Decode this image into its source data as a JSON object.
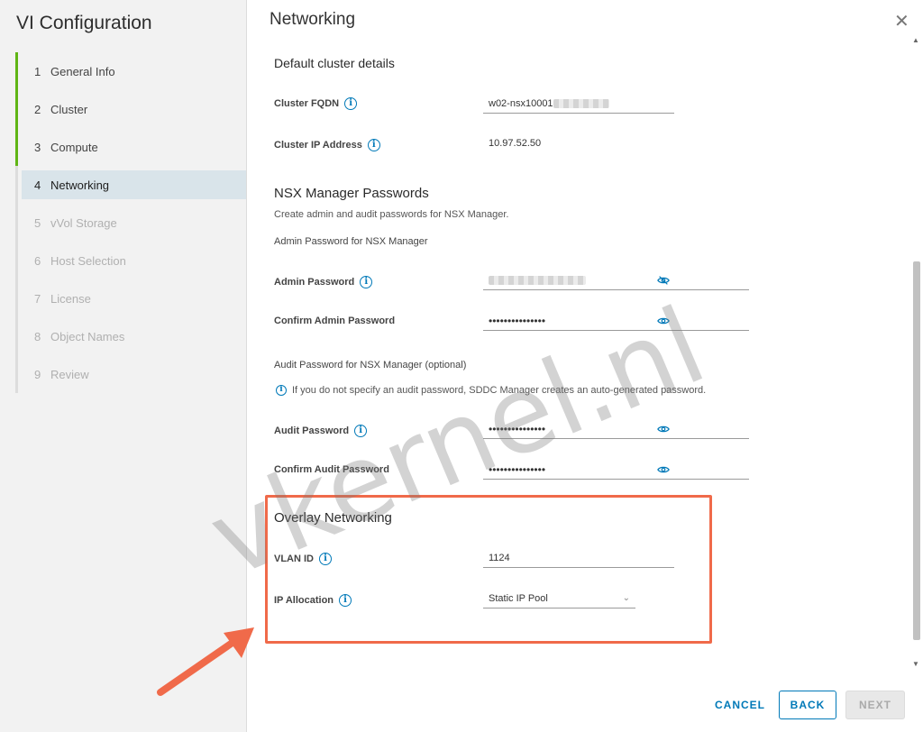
{
  "wizard": {
    "title": "VI Configuration",
    "steps": [
      {
        "num": "1",
        "label": "General Info"
      },
      {
        "num": "2",
        "label": "Cluster"
      },
      {
        "num": "3",
        "label": "Compute"
      },
      {
        "num": "4",
        "label": "Networking"
      },
      {
        "num": "5",
        "label": "vVol Storage"
      },
      {
        "num": "6",
        "label": "Host Selection"
      },
      {
        "num": "7",
        "label": "License"
      },
      {
        "num": "8",
        "label": "Object Names"
      },
      {
        "num": "9",
        "label": "Review"
      }
    ]
  },
  "page": {
    "title": "Networking"
  },
  "cluster": {
    "heading": "Default cluster details",
    "fqdn_label": "Cluster FQDN",
    "fqdn_value": "w02-nsx10001",
    "ip_label": "Cluster IP Address",
    "ip_value": "10.97.52.50"
  },
  "nsx": {
    "heading": "NSX Manager Passwords",
    "description": "Create admin and audit passwords for NSX Manager.",
    "admin_heading": "Admin Password for NSX Manager",
    "admin_label": "Admin Password",
    "confirm_admin_label": "Confirm Admin Password",
    "confirm_admin_value": "•••••••••••••••",
    "audit_heading": "Audit Password for NSX Manager (optional)",
    "audit_note": "If you do not specify an audit password, SDDC Manager creates an auto-generated password.",
    "audit_label": "Audit Password",
    "audit_value": "•••••••••••••••",
    "confirm_audit_label": "Confirm Audit Password",
    "confirm_audit_value": "•••••••••••••••"
  },
  "overlay": {
    "heading": "Overlay Networking",
    "vlan_label": "VLAN ID",
    "vlan_value": "1124",
    "ip_alloc_label": "IP Allocation",
    "ip_alloc_value": "Static IP Pool"
  },
  "footer": {
    "cancel": "CANCEL",
    "back": "BACK",
    "next": "NEXT"
  },
  "watermark": "vkernel.nl",
  "colors": {
    "accent": "#0079b8",
    "done": "#60b515",
    "highlight": "#f06a4a"
  }
}
